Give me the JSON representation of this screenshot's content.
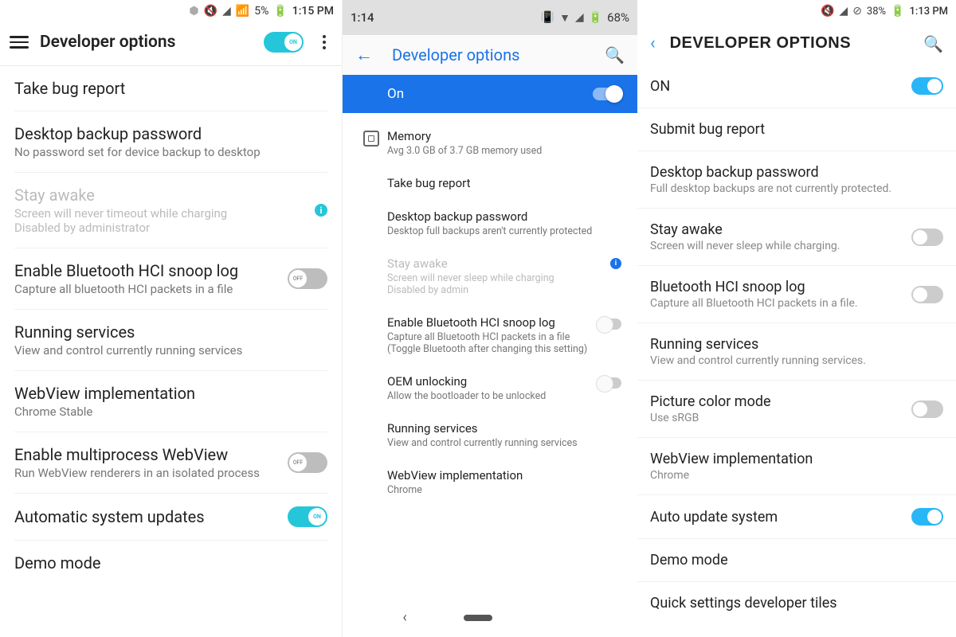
{
  "phone1": {
    "status": {
      "battery": "5%",
      "time": "1:15 PM"
    },
    "header": {
      "title": "Developer options",
      "toggle_label": "ON"
    },
    "items": [
      {
        "title": "Take bug report"
      },
      {
        "title": "Desktop backup password",
        "sub": "No password set for device backup to desktop"
      },
      {
        "title": "Stay awake",
        "sub": "Screen will never timeout while charging\nDisabled by administrator"
      },
      {
        "title": "Enable Bluetooth HCI snoop log",
        "sub": "Capture all bluetooth HCI packets in a file",
        "toggle": "OFF"
      },
      {
        "title": "Running services",
        "sub": "View and control currently running services"
      },
      {
        "title": "WebView implementation",
        "sub": "Chrome Stable"
      },
      {
        "title": "Enable multiprocess WebView",
        "sub": "Run WebView renderers in an isolated process",
        "toggle": "OFF"
      },
      {
        "title": "Automatic system updates",
        "toggle": "ON"
      },
      {
        "title": "Demo mode"
      }
    ]
  },
  "phone2": {
    "status": {
      "time": "1:14",
      "battery": "68%"
    },
    "header": {
      "title": "Developer options"
    },
    "on_label": "On",
    "items": [
      {
        "title": "Memory",
        "sub": "Avg 3.0 GB of 3.7 GB memory used",
        "icon": true
      },
      {
        "title": "Take bug report"
      },
      {
        "title": "Desktop backup password",
        "sub": "Desktop full backups aren't currently protected"
      },
      {
        "title": "Stay awake",
        "sub": "Screen will never sleep while charging\nDisabled by admin",
        "disabled": true,
        "info": true
      },
      {
        "title": "Enable Bluetooth HCI snoop log",
        "sub": "Capture all Bluetooth HCI packets in a file (Toggle Bluetooth after changing this setting)",
        "switch": true
      },
      {
        "title": "OEM unlocking",
        "sub": "Allow the bootloader to be unlocked",
        "switch": true
      },
      {
        "title": "Running services",
        "sub": "View and control currently running services"
      },
      {
        "title": "WebView implementation",
        "sub": "Chrome"
      }
    ]
  },
  "phone3": {
    "status": {
      "battery": "38%",
      "time": "1:13 PM"
    },
    "header": {
      "title": "DEVELOPER OPTIONS"
    },
    "on_label": "ON",
    "items": [
      {
        "title": "Submit bug report"
      },
      {
        "title": "Desktop backup password",
        "sub": "Full desktop backups are not currently protected."
      },
      {
        "title": "Stay awake",
        "sub": "Screen will never sleep while charging.",
        "switch": "off"
      },
      {
        "title": "Bluetooth HCI snoop log",
        "sub": "Capture all Bluetooth HCI packets in a file.",
        "switch": "off"
      },
      {
        "title": "Running services",
        "sub": "View and control currently running services."
      },
      {
        "title": "Picture color mode",
        "sub": "Use sRGB",
        "switch": "off"
      },
      {
        "title": "WebView implementation",
        "sub": "Chrome"
      },
      {
        "title": "Auto update system",
        "switch": "on"
      },
      {
        "title": "Demo mode"
      },
      {
        "title": "Quick settings developer tiles"
      }
    ]
  }
}
